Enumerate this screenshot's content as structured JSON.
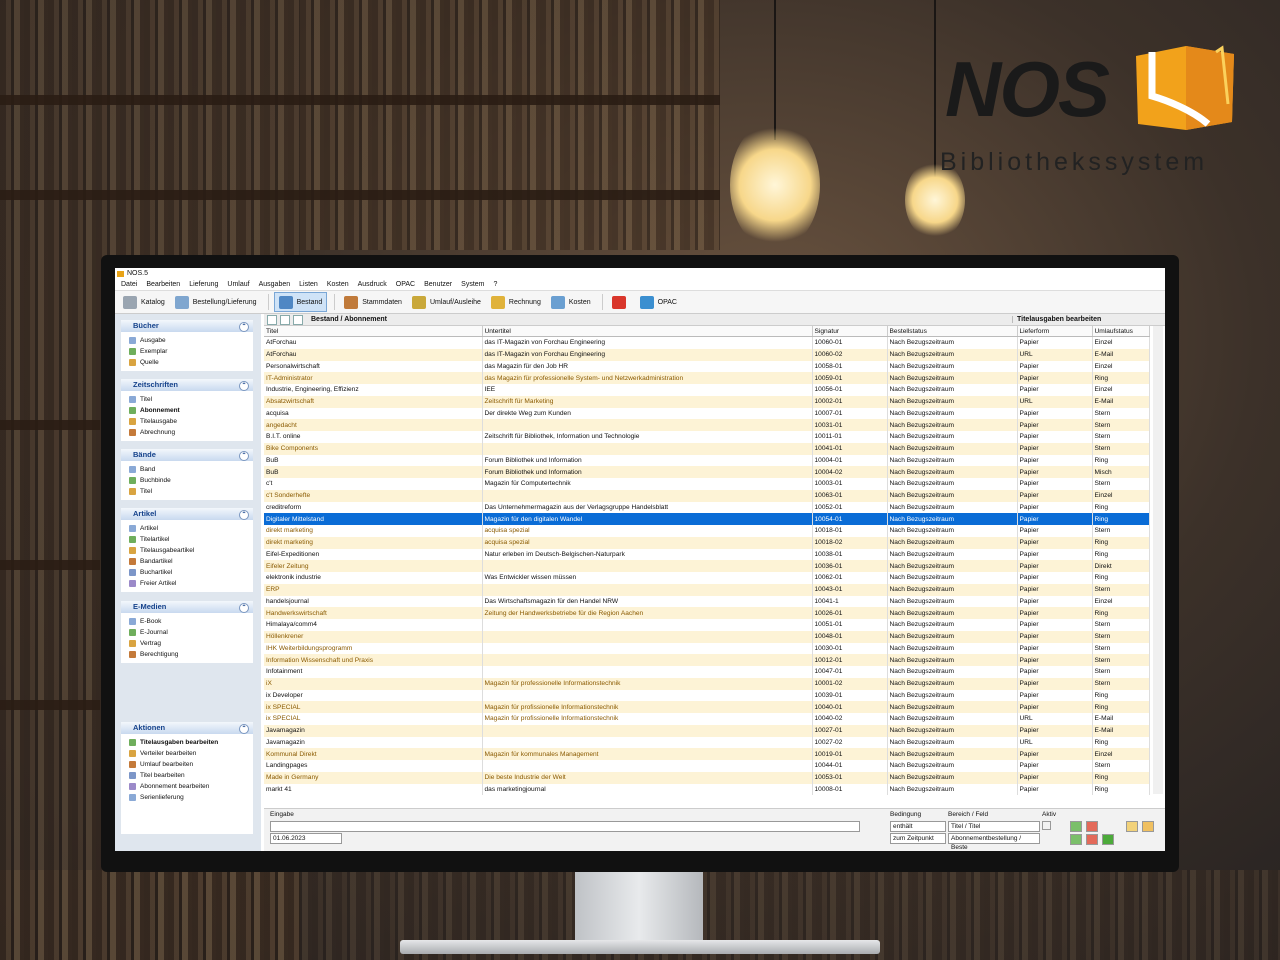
{
  "logo": {
    "name": "NOS",
    "subtitle": "Bibliothekssystem"
  },
  "app": {
    "title": "NOS.5",
    "menu": [
      "Datei",
      "Bearbeiten",
      "Lieferung",
      "Umlauf",
      "Ausgaben",
      "Listen",
      "Kosten",
      "Ausdruck",
      "OPAC",
      "Benutzer",
      "System",
      "?"
    ],
    "toolbar": [
      {
        "label": "Katalog",
        "icon": "catalog-icon",
        "color": "#9aa5b1"
      },
      {
        "label": "Bestellung/Lieferung",
        "icon": "delivery-icon",
        "color": "#7fa6cf"
      },
      {
        "label": "Bestand",
        "icon": "inventory-icon",
        "color": "#4f87c4"
      },
      {
        "label": "Stammdaten",
        "icon": "masterdata-icon",
        "color": "#c07a3a"
      },
      {
        "label": "Umlauf/Ausleihe",
        "icon": "circulation-icon",
        "color": "#c9a83a"
      },
      {
        "label": "Rechnung",
        "icon": "invoice-icon",
        "color": "#e0b23a"
      },
      {
        "label": "Kosten",
        "icon": "costs-icon",
        "color": "#6a9fd1"
      },
      {
        "label": "",
        "icon": "pdf-icon",
        "color": "#d9362b"
      },
      {
        "label": "OPAC",
        "icon": "globe-icon",
        "color": "#3b8fd0"
      }
    ],
    "sidebar": {
      "panels": [
        {
          "title": "Bücher",
          "items": [
            "Ausgabe",
            "Exemplar",
            "Quelle"
          ]
        },
        {
          "title": "Zeitschriften",
          "items": [
            "Titel",
            "Abonnement",
            "Titelausgabe",
            "Abrechnung"
          ]
        },
        {
          "title": "Bände",
          "items": [
            "Band",
            "Buchbinde",
            "Titel"
          ]
        },
        {
          "title": "Artikel",
          "items": [
            "Artikel",
            "Titelartikel",
            "Titelausgabeartikel",
            "Bandartikel",
            "Buchartikel",
            "Freier Artikel"
          ]
        },
        {
          "title": "E-Medien",
          "items": [
            "E-Book",
            "E-Journal",
            "Vertrag",
            "Berechtigung"
          ]
        }
      ],
      "aktionen": {
        "title": "Aktionen",
        "items": [
          "Titelausgaben bearbeiten",
          "Verteiler bearbeiten",
          "Umlauf bearbeiten",
          "Titel bearbeiten",
          "Abonnement bearbeiten",
          "Serienlieferung"
        ]
      }
    },
    "content": {
      "title": "Bestand / Abonnement",
      "right_title": "Titelausgaben bearbeiten",
      "columns": [
        "Titel",
        "Untertitel",
        "Signatur",
        "Bestellstatus",
        "Lieferform",
        "Umlaufstatus"
      ],
      "rows": [
        [
          "AtForchau",
          "das IT-Magazin von Forchau Engineering",
          "10060-01",
          "Nach Bezugszeitraum",
          "Papier",
          "Einzel"
        ],
        [
          "AtForchau",
          "das IT-Magazin von Forchau Engineering",
          "10060-02",
          "Nach Bezugszeitraum",
          "URL",
          "E-Mail"
        ],
        [
          "Personalwirtschaft",
          "das Magazin für den Job HR",
          "10058-01",
          "Nach Bezugszeitraum",
          "Papier",
          "Einzel"
        ],
        [
          "IT-Administrator",
          "das Magazin für professionelle System- und Netzwerkadministration",
          "10059-01",
          "Nach Bezugszeitraum",
          "Papier",
          "Ring"
        ],
        [
          "Industrie, Engineering, Effizienz",
          "IEE",
          "10056-01",
          "Nach Bezugszeitraum",
          "Papier",
          "Einzel"
        ],
        [
          "Absatzwirtschaft",
          "Zeitschrift für Marketing",
          "10002-01",
          "Nach Bezugszeitraum",
          "URL",
          "E-Mail"
        ],
        [
          "acquisa",
          "Der direkte Weg zum Kunden",
          "10007-01",
          "Nach Bezugszeitraum",
          "Papier",
          "Stern"
        ],
        [
          "angedacht",
          "",
          "10031-01",
          "Nach Bezugszeitraum",
          "Papier",
          "Stern"
        ],
        [
          "B.I.T. online",
          "Zeitschrift für Bibliothek, Information und Technologie",
          "10011-01",
          "Nach Bezugszeitraum",
          "Papier",
          "Stern"
        ],
        [
          "Bike Components",
          "",
          "10041-01",
          "Nach Bezugszeitraum",
          "Papier",
          "Stern"
        ],
        [
          "BuB",
          "Forum Bibliothek und Information",
          "10004-01",
          "Nach Bezugszeitraum",
          "Papier",
          "Ring"
        ],
        [
          "BuB",
          "Forum Bibliothek und Information",
          "10004-02",
          "Nach Bezugszeitraum",
          "Papier",
          "Misch"
        ],
        [
          "c't",
          "Magazin für Computertechnik",
          "10003-01",
          "Nach Bezugszeitraum",
          "Papier",
          "Stern"
        ],
        [
          "c't Sonderhefte",
          "",
          "10063-01",
          "Nach Bezugszeitraum",
          "Papier",
          "Einzel"
        ],
        [
          "creditreform",
          "Das Unternehmermagazin aus der Verlagsgruppe Handelsblatt",
          "10052-01",
          "Nach Bezugszeitraum",
          "Papier",
          "Ring"
        ],
        [
          "Digitaler Mittelstand",
          "Magazin für den digitalen Wandel",
          "10054-01",
          "Nach Bezugszeitraum",
          "Papier",
          "Ring"
        ],
        [
          "direkt marketing",
          "acquisa spezial",
          "10018-01",
          "Nach Bezugszeitraum",
          "Papier",
          "Stern"
        ],
        [
          "direkt marketing",
          "acquisa spezial",
          "10018-02",
          "Nach Bezugszeitraum",
          "Papier",
          "Ring"
        ],
        [
          "Eifel-Expeditionen",
          "Natur erleben im Deutsch-Belgischen-Naturpark",
          "10038-01",
          "Nach Bezugszeitraum",
          "Papier",
          "Ring"
        ],
        [
          "Eifeler Zeitung",
          "",
          "10036-01",
          "Nach Bezugszeitraum",
          "Papier",
          "Direkt"
        ],
        [
          "elektronik industrie",
          "Was Entwickler wissen müssen",
          "10062-01",
          "Nach Bezugszeitraum",
          "Papier",
          "Ring"
        ],
        [
          "ERP",
          "",
          "10043-01",
          "Nach Bezugszeitraum",
          "Papier",
          "Stern"
        ],
        [
          "handelsjournal",
          "Das Wirtschaftsmagazin für den Handel NRW",
          "10041-1",
          "Nach Bezugszeitraum",
          "Papier",
          "Einzel"
        ],
        [
          "Handwerkswirtschaft",
          "Zeitung der Handwerksbetriebe für die Region Aachen",
          "10026-01",
          "Nach Bezugszeitraum",
          "Papier",
          "Ring"
        ],
        [
          "Himalaya/comm4",
          "",
          "10051-01",
          "Nach Bezugszeitraum",
          "Papier",
          "Stern"
        ],
        [
          "Höllenkrener",
          "",
          "10048-01",
          "Nach Bezugszeitraum",
          "Papier",
          "Stern"
        ],
        [
          "IHK Weiterbildungsprogramm",
          "",
          "10030-01",
          "Nach Bezugszeitraum",
          "Papier",
          "Stern"
        ],
        [
          "Information Wissenschaft und Praxis",
          "",
          "10012-01",
          "Nach Bezugszeitraum",
          "Papier",
          "Stern"
        ],
        [
          "Infotainment",
          "",
          "10047-01",
          "Nach Bezugszeitraum",
          "Papier",
          "Stern"
        ],
        [
          "iX",
          "Magazin für professionelle Informationstechnik",
          "10001-02",
          "Nach Bezugszeitraum",
          "Papier",
          "Stern"
        ],
        [
          "ix Developer",
          "",
          "10039-01",
          "Nach Bezugszeitraum",
          "Papier",
          "Ring"
        ],
        [
          "ix SPECIAL",
          "Magazin für profissionelle Informationstechnik",
          "10040-01",
          "Nach Bezugszeitraum",
          "Papier",
          "Ring"
        ],
        [
          "ix SPECIAL",
          "Magazin für profissionelle Informationstechnik",
          "10040-02",
          "Nach Bezugszeitraum",
          "URL",
          "E-Mail"
        ],
        [
          "Javamagazin",
          "",
          "10027-01",
          "Nach Bezugszeitraum",
          "Papier",
          "E-Mail"
        ],
        [
          "Javamagazin",
          "",
          "10027-02",
          "Nach Bezugszeitraum",
          "URL",
          "Ring"
        ],
        [
          "Kommunal Direkt",
          "Magazin für kommunales Management",
          "10019-01",
          "Nach Bezugszeitraum",
          "Papier",
          "Einzel"
        ],
        [
          "Landingpages",
          "",
          "10044-01",
          "Nach Bezugszeitraum",
          "Papier",
          "Stern"
        ],
        [
          "Made in Germany",
          "Die beste Industrie der Welt",
          "10053-01",
          "Nach Bezugszeitraum",
          "Papier",
          "Ring"
        ],
        [
          "markt 41",
          "das marketingjournal",
          "10008-01",
          "Nach Bezugszeitraum",
          "Papier",
          "Ring"
        ]
      ],
      "selected_row": 15,
      "yellow_rows": [
        3,
        5,
        7,
        9,
        13,
        15,
        16,
        17,
        19,
        21,
        23,
        25,
        26,
        27,
        29,
        31,
        32,
        35,
        37
      ]
    },
    "bottom": {
      "eingabe_label": "Eingabe",
      "date": "01.06.2023",
      "bedingung_label": "Bedingung",
      "bedingung_value": "enthält",
      "zeitpunkt": "zum Zeitpunkt",
      "bereich_label": "Bereich / Feld",
      "bereich_value": "Titel / Titel",
      "bereich_value2": "Abonnementbestellung / Beste",
      "aktiv_label": "Aktiv"
    }
  }
}
